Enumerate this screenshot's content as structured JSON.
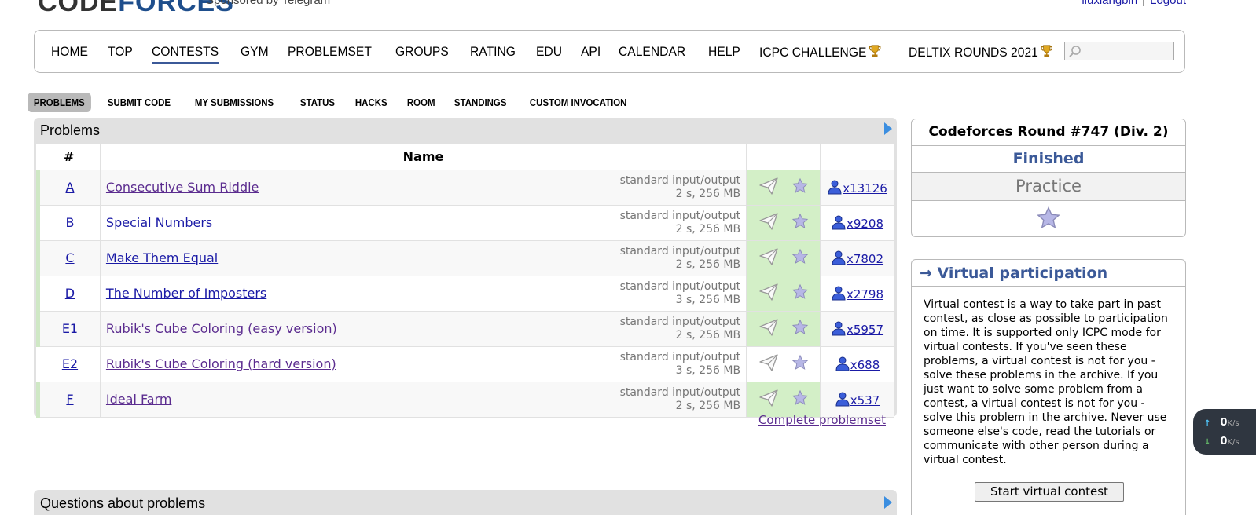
{
  "header": {
    "logo_part1": "CODE",
    "logo_part2": "FORCES",
    "sponsor": "Sponsored by Telegram",
    "username": "liuxiangbin",
    "logout": "Logout"
  },
  "main_menu": {
    "items": [
      "HOME",
      "TOP",
      "CONTESTS",
      "GYM",
      "PROBLEMSET",
      "GROUPS",
      "RATING",
      "EDU",
      "API",
      "CALENDAR",
      "HELP",
      "ICPC CHALLENGE",
      "DELTIX ROUNDS 2021"
    ],
    "active": "CONTESTS",
    "search_placeholder": ""
  },
  "second_menu": {
    "items": [
      "PROBLEMS",
      "SUBMIT CODE",
      "MY SUBMISSIONS",
      "STATUS",
      "HACKS",
      "ROOM",
      "STANDINGS",
      "CUSTOM INVOCATION"
    ],
    "active": "PROBLEMS"
  },
  "problems": {
    "title": "Problems",
    "columns": {
      "index": "#",
      "name": "Name"
    },
    "rows": [
      {
        "index": "A",
        "name": "Consecutive Sum Riddle",
        "io": "standard input/output",
        "limits": "2 s, 256 MB",
        "solvers": "x13126",
        "solved": true
      },
      {
        "index": "B",
        "name": "Special Numbers",
        "io": "standard input/output",
        "limits": "2 s, 256 MB",
        "solvers": "x9208",
        "solved": true
      },
      {
        "index": "C",
        "name": "Make Them Equal",
        "io": "standard input/output",
        "limits": "2 s, 256 MB",
        "solvers": "x7802",
        "solved": true
      },
      {
        "index": "D",
        "name": "The Number of Imposters",
        "io": "standard input/output",
        "limits": "3 s, 256 MB",
        "solvers": "x2798",
        "solved": true
      },
      {
        "index": "E1",
        "name": "Rubik's Cube Coloring (easy version)",
        "io": "standard input/output",
        "limits": "2 s, 256 MB",
        "solvers": "x5957",
        "solved": true
      },
      {
        "index": "E2",
        "name": "Rubik's Cube Coloring (hard version)",
        "io": "standard input/output",
        "limits": "3 s, 256 MB",
        "solvers": "x688",
        "solved": false
      },
      {
        "index": "F",
        "name": "Ideal Farm",
        "io": "standard input/output",
        "limits": "2 s, 256 MB",
        "solvers": "x537",
        "solved": true
      }
    ],
    "complete_link": "Complete problemset"
  },
  "questions": {
    "title": "Questions about problems"
  },
  "sidebar": {
    "round_title": "Codeforces Round #747 (Div. 2)",
    "status": "Finished",
    "phase": "Practice",
    "vp_title": "→ Virtual participation",
    "vp_text": "Virtual contest is a way to take part in past contest, as close as possible to participation on time. It is supported only ICPC mode for virtual contests. If you've seen these problems, a virtual contest is not for you - solve these problems in the archive. If you just want to solve some problem from a contest, a virtual contest is not for you - solve this problem in the archive. Never use someone else's code, read the tutorials or communicate with other person during a virtual contest.",
    "vp_button": "Start virtual contest"
  },
  "network": {
    "up": "0",
    "down": "0",
    "unit": "K/s"
  },
  "colors": {
    "accent": "#3b5998",
    "link": "#1a1aa6",
    "visited": "#5b2c8f",
    "accepted_bg": "#d3efc7"
  }
}
